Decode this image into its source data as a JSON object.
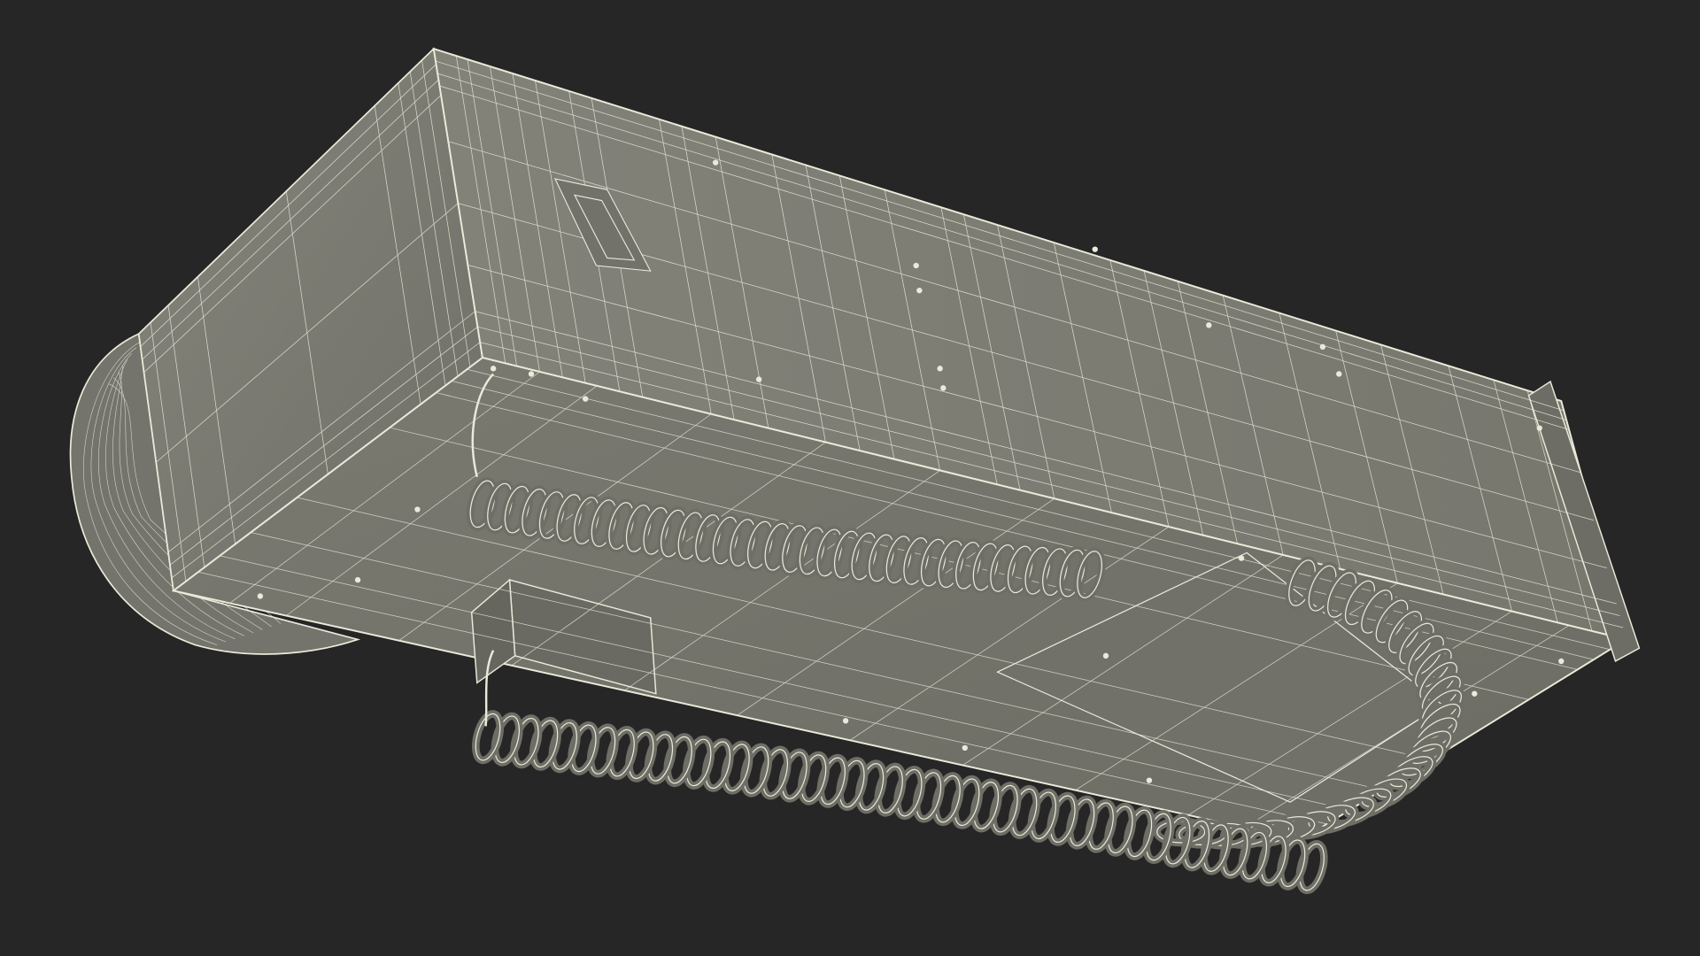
{
  "scene": {
    "subject": "wireframe-render",
    "background_color": "#262626",
    "surface_color": "#7d7d74",
    "surface_shade_color": "#6f6f67",
    "wire_color": "#e9ead9",
    "icons": [
      "wall-phone-body",
      "handset-receiver",
      "coiled-cord",
      "wall-bracket"
    ]
  }
}
